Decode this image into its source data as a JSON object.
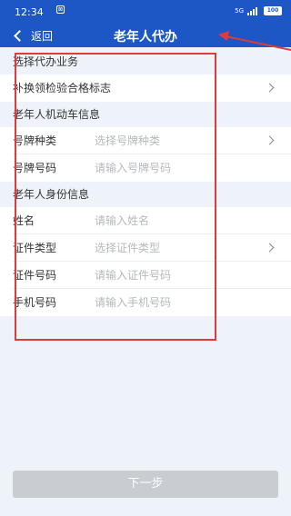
{
  "status_bar": {
    "time": "12:34",
    "notification": "⊠",
    "network": "5G",
    "battery": "100"
  },
  "nav": {
    "back_label": "返回",
    "title": "老年人代办"
  },
  "sections": {
    "business": {
      "title": "选择代办业务",
      "row_label": "补换领检验合格标志"
    },
    "vehicle": {
      "title": "老年人机动车信息",
      "plate_type_label": "号牌种类",
      "plate_type_placeholder": "选择号牌种类",
      "plate_number_label": "号牌号码",
      "plate_number_placeholder": "请输入号牌号码"
    },
    "identity": {
      "title": "老年人身份信息",
      "name_label": "姓名",
      "name_placeholder": "请输入姓名",
      "id_type_label": "证件类型",
      "id_type_placeholder": "选择证件类型",
      "id_number_label": "证件号码",
      "id_number_placeholder": "请输入证件号码",
      "phone_label": "手机号码",
      "phone_placeholder": "请输入手机号码"
    }
  },
  "next_button": "下一步",
  "colors": {
    "primary": "#1d56c5",
    "annotation": "#e03b3b",
    "disabled_button": "#c9ccd1"
  }
}
